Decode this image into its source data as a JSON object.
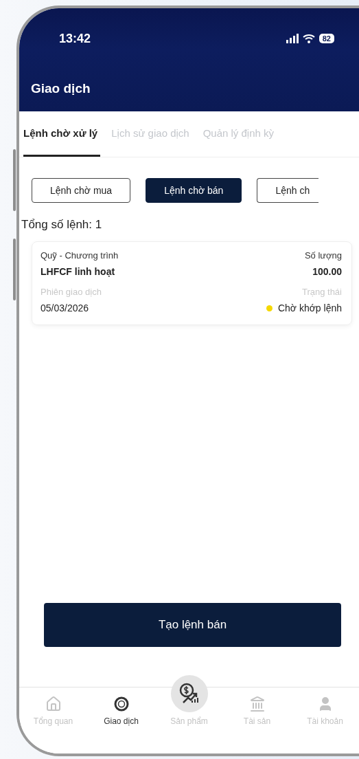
{
  "status_bar": {
    "time": "13:42",
    "battery": "82"
  },
  "header": {
    "title": "Giao dịch"
  },
  "tabs": [
    {
      "label": "Lệnh chờ xử lý",
      "selected": true
    },
    {
      "label": "Lịch sử giao dịch",
      "selected": false
    },
    {
      "label": "Quản lý định kỳ",
      "selected": false
    }
  ],
  "filters": [
    {
      "label": "Lệnh chờ mua",
      "selected": false
    },
    {
      "label": "Lệnh chờ bán",
      "selected": true
    },
    {
      "label": "Lệnh ch",
      "selected": false
    }
  ],
  "total": "Tổng số lệnh: 1",
  "orders": [
    {
      "fund_label": "Quỹ - Chương trình",
      "fund": "LHFCF linh hoạt",
      "qty_label": "Số lượng",
      "qty": "100.00",
      "session_label": "Phiên giao dịch",
      "session": "05/03/2026",
      "status_label": "Trạng thái",
      "status": "Chờ khớp lệnh",
      "color": "#f5d800"
    }
  ],
  "primary_button": "Tạo lệnh bán",
  "nav": [
    {
      "label": "Tổng quan",
      "kind": "home",
      "selected": false
    },
    {
      "label": "Giao dịch",
      "kind": "exchange",
      "selected": true
    },
    {
      "label": "Sản phẩm",
      "kind": "product",
      "selected": false
    },
    {
      "label": "Tài sản",
      "kind": "bank",
      "selected": false
    },
    {
      "label": "Tài khoản",
      "kind": "user",
      "selected": false
    }
  ]
}
